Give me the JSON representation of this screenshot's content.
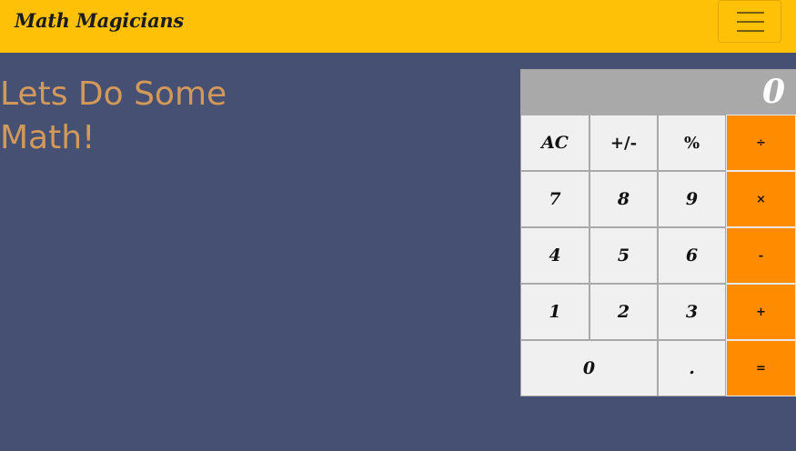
{
  "navbar": {
    "brand": "Math Magicians",
    "menu_toggle_icon": "hamburger-menu-icon"
  },
  "main": {
    "headline": "Lets Do Some Math!"
  },
  "calculator": {
    "display": "0",
    "keys": {
      "ac": "AC",
      "plus_minus": "+/-",
      "percent": "%",
      "divide": "÷",
      "seven": "7",
      "eight": "8",
      "nine": "9",
      "multiply": "×",
      "four": "4",
      "five": "5",
      "six": "6",
      "minus": "-",
      "one": "1",
      "two": "2",
      "three": "3",
      "plus": "+",
      "zero": "0",
      "dot": ".",
      "equals": "="
    }
  },
  "colors": {
    "navbar_bg": "#ffc107",
    "page_bg": "#465072",
    "headline": "#d3995a",
    "display_bg": "#a9a9a9",
    "key_bg": "#f0f0f0",
    "operator_bg": "#ff8c00"
  }
}
